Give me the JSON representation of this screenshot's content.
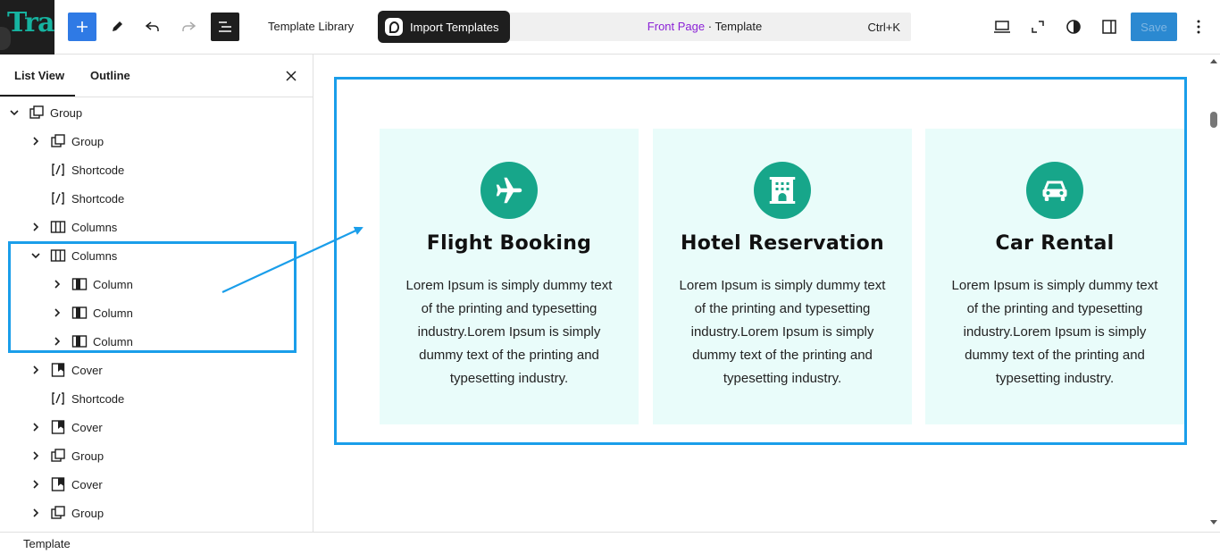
{
  "header": {
    "logo_text": "Tra",
    "template_library_label": "Template Library",
    "import_templates_label": "Import Templates",
    "command_bar": {
      "page_name": "Front Page",
      "separator": " · ",
      "type": "Template",
      "shortcut": "Ctrl+K"
    },
    "save_label": "Save"
  },
  "sidebar": {
    "tabs": [
      {
        "label": "List View",
        "active": true
      },
      {
        "label": "Outline",
        "active": false
      }
    ],
    "tree": [
      {
        "label": "Group",
        "icon": "group-icon",
        "chevron": "down"
      },
      {
        "label": "Group",
        "icon": "group-icon",
        "chevron": "right"
      },
      {
        "label": "Shortcode",
        "icon": "shortcode-icon",
        "chevron": "none"
      },
      {
        "label": "Shortcode",
        "icon": "shortcode-icon",
        "chevron": "none"
      },
      {
        "label": "Columns",
        "icon": "columns-icon",
        "chevron": "right"
      },
      {
        "label": "Columns",
        "icon": "columns-icon",
        "chevron": "down"
      },
      {
        "label": "Column",
        "icon": "column-icon",
        "chevron": "right"
      },
      {
        "label": "Column",
        "icon": "column-icon",
        "chevron": "right"
      },
      {
        "label": "Column",
        "icon": "column-icon",
        "chevron": "right"
      },
      {
        "label": "Cover",
        "icon": "cover-icon",
        "chevron": "right"
      },
      {
        "label": "Shortcode",
        "icon": "shortcode-icon",
        "chevron": "none"
      },
      {
        "label": "Cover",
        "icon": "cover-icon",
        "chevron": "right"
      },
      {
        "label": "Group",
        "icon": "group-icon",
        "chevron": "right"
      },
      {
        "label": "Cover",
        "icon": "cover-icon",
        "chevron": "right"
      },
      {
        "label": "Group",
        "icon": "group-icon",
        "chevron": "right"
      }
    ]
  },
  "canvas": {
    "cards": [
      {
        "icon": "airplane-icon",
        "title": "Flight Booking",
        "body": "Lorem Ipsum is simply dummy text of the printing and typesetting industry.Lorem Ipsum is simply dummy text of the printing and typesetting industry."
      },
      {
        "icon": "hotel-icon",
        "title": "Hotel Reservation",
        "body": "Lorem Ipsum is simply dummy text of the printing and typesetting industry.Lorem Ipsum is simply dummy text of the printing and typesetting industry."
      },
      {
        "icon": "car-icon",
        "title": "Car Rental",
        "body": "Lorem Ipsum is simply dummy text of the printing and typesetting industry.Lorem Ipsum is simply dummy text of the printing and typesetting industry."
      }
    ]
  },
  "footer": {
    "breadcrumb": "Template"
  },
  "colors": {
    "accent": "#1a9eea",
    "card_bg": "#e9fcfa",
    "icon_circle": "#17a68a",
    "front_page_link": "#8b22d6"
  }
}
